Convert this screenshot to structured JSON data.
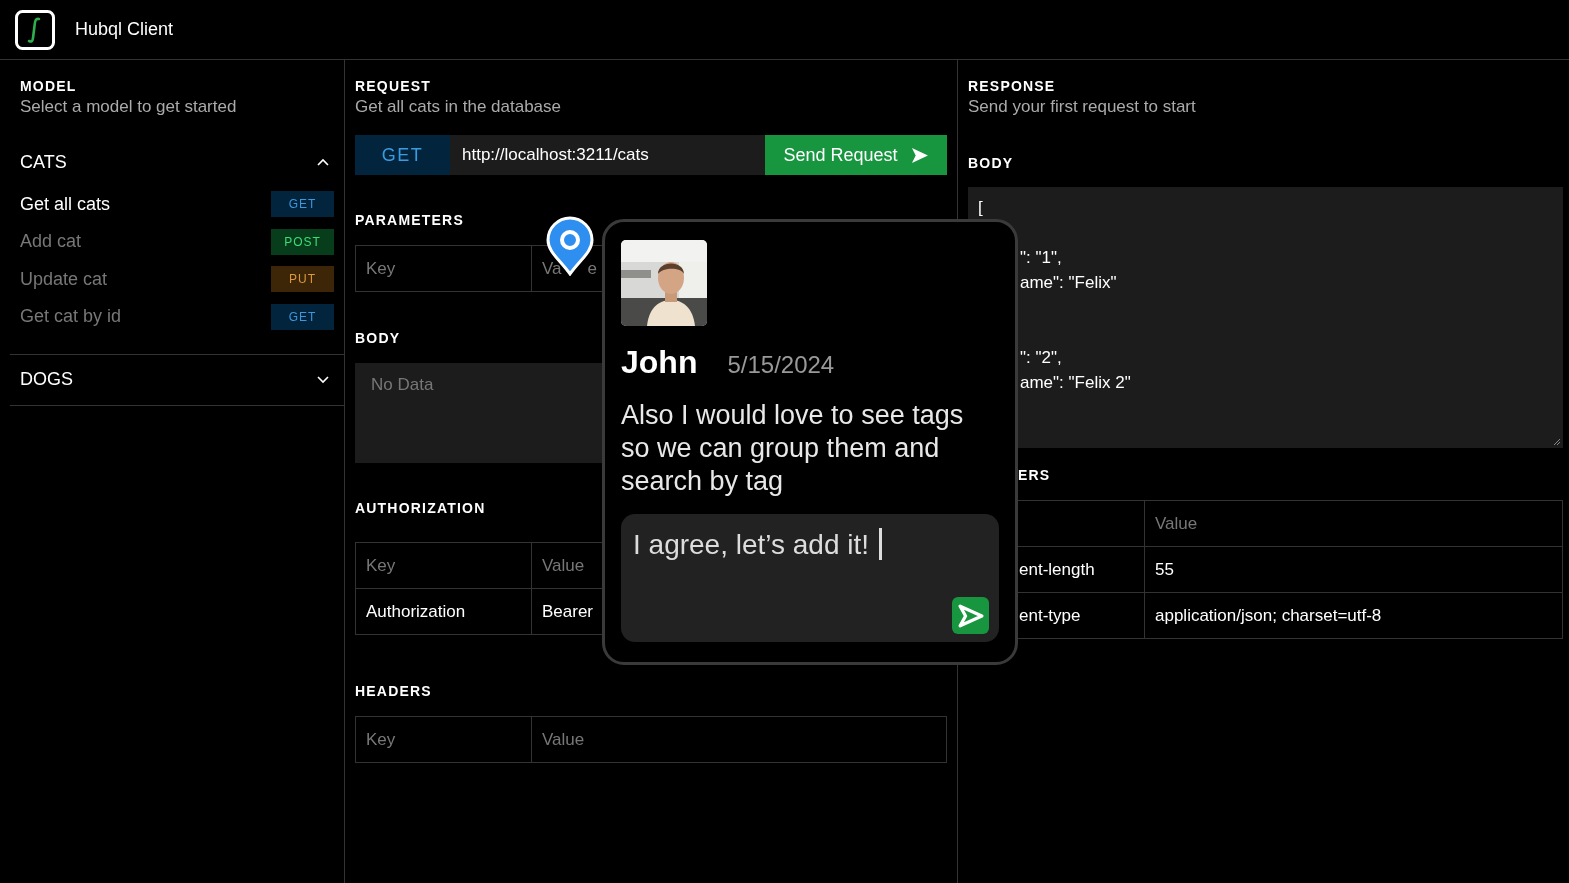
{
  "app": {
    "title": "Hubql Client"
  },
  "sidebar": {
    "heading": "MODEL",
    "subtitle": "Select a model to get started",
    "groups": [
      {
        "name": "CATS",
        "expanded": true,
        "items": [
          {
            "label": "Get all cats",
            "method": "GET",
            "color": "#03243d",
            "selected": true
          },
          {
            "label": "Add cat",
            "method": "POST",
            "color": "#073d1a",
            "selected": false
          },
          {
            "label": "Update cat",
            "method": "PUT",
            "color": "#3d2608",
            "selected": false
          },
          {
            "label": "Get cat by id",
            "method": "GET",
            "color": "#03243d",
            "selected": false
          }
        ]
      },
      {
        "name": "DOGS",
        "expanded": false
      }
    ]
  },
  "request": {
    "heading": "REQUEST",
    "subtitle": "Get all cats in the database",
    "method": "GET",
    "url": "http://localhost:3211/cats",
    "send_label": "Send Request",
    "parameters": {
      "heading": "PARAMETERS",
      "key_placeholder": "Key",
      "value_placeholder_parts": [
        "Va",
        "e"
      ]
    },
    "body": {
      "heading": "BODY",
      "placeholder": "No Data"
    },
    "authorization": {
      "heading": "AUTHORIZATION",
      "columns": [
        "Key",
        "Value"
      ],
      "rows": [
        [
          "Authorization",
          "Bearer"
        ]
      ]
    },
    "headers": {
      "heading": "HEADERS",
      "key_placeholder": "Key",
      "value_placeholder": "Value"
    }
  },
  "response": {
    "heading": "RESPONSE",
    "subtitle": "Send your first request to start",
    "body": {
      "heading": "BODY",
      "first_line": "[",
      "objects": [
        [
          "\": \"1\",",
          "ame\": \"Felix\""
        ],
        [
          "\": \"2\",",
          "ame\": \"Felix 2\""
        ]
      ]
    },
    "headers": {
      "heading": "ERS",
      "columns": [
        "",
        "Value"
      ],
      "rows": [
        [
          "ent-length",
          "55"
        ],
        [
          "ent-type",
          "application/json; charset=utf-8"
        ]
      ]
    }
  },
  "comment": {
    "author": "John",
    "date": "5/15/2024",
    "text": "Also I would love to see tags so we can group them and search by tag",
    "reply": {
      "value": "I agree, let’s add it!"
    }
  }
}
